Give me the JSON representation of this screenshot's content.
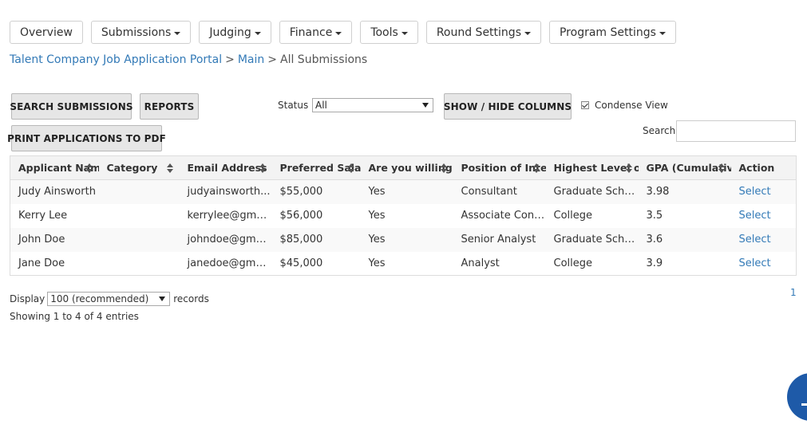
{
  "nav": {
    "items": [
      {
        "label": "Overview",
        "dropdown": false
      },
      {
        "label": "Submissions",
        "dropdown": true
      },
      {
        "label": "Judging",
        "dropdown": true
      },
      {
        "label": "Finance",
        "dropdown": true
      },
      {
        "label": "Tools",
        "dropdown": true
      },
      {
        "label": "Round Settings",
        "dropdown": true
      },
      {
        "label": "Program Settings",
        "dropdown": true
      }
    ]
  },
  "breadcrumb": {
    "portal": "Talent Company Job Application Portal",
    "main": "Main",
    "current": "All Submissions",
    "separator": ">"
  },
  "toolbar": {
    "search_submissions": "SEARCH SUBMISSIONS",
    "reports": "REPORTS",
    "print_pdf": "PRINT APPLICATIONS TO PDF",
    "status_label": "Status",
    "status_value": "All",
    "show_hide_columns": "SHOW / HIDE COLUMNS",
    "condense_view": "Condense View",
    "search_label": "Search:"
  },
  "table": {
    "headers": [
      "Applicant Name",
      "Category",
      "Email Address",
      "Preferred Salary",
      "Are you willing",
      "Position of Inte",
      "Highest Level of...",
      "GPA (Cumulative)",
      "Action"
    ],
    "rows": [
      [
        "Judy Ainsworth",
        "",
        "judyainsworth...",
        "$55,000",
        "Yes",
        "Consultant",
        "Graduate School",
        "3.98",
        "Select"
      ],
      [
        "Kerry Lee",
        "",
        "kerrylee@gmai...",
        "$56,000",
        "Yes",
        "Associate Cons...",
        "College",
        "3.5",
        "Select"
      ],
      [
        "John Doe",
        "",
        "johndoe@gmai...",
        "$85,000",
        "Yes",
        "Senior Analyst",
        "Graduate School",
        "3.6",
        "Select"
      ],
      [
        "Jane Doe",
        "",
        "janedoe@gmai...",
        "$45,000",
        "Yes",
        "Analyst",
        "College",
        "3.9",
        "Select"
      ]
    ]
  },
  "footer": {
    "display_label": "Display",
    "display_value": "100 (recommended)",
    "records_label": "records",
    "showing": "Showing 1 to 4 of 4 entries",
    "page": "1"
  },
  "colors": {
    "link": "#337ab7",
    "header_bg": "#f3f3f3",
    "button_bg": "#e6e6e6",
    "chat": "#1e5aa8"
  }
}
